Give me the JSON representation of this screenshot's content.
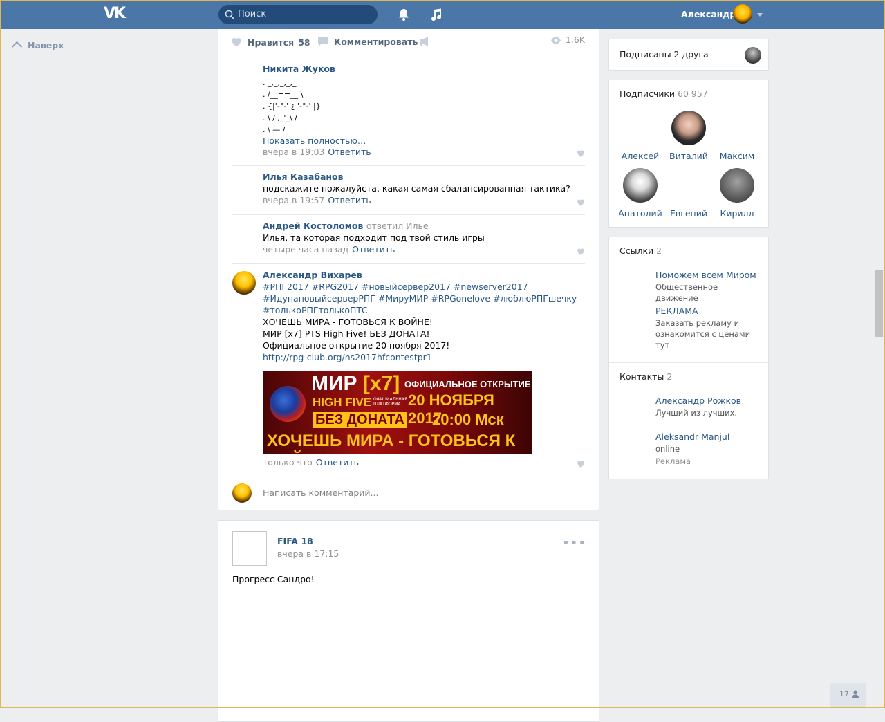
{
  "topbar": {
    "logo": "VK",
    "search_placeholder": "Поиск",
    "user_name": "Александр"
  },
  "left": {
    "up_label": "Наверх"
  },
  "post": {
    "like_label": "Нравится",
    "like_count": "58",
    "comment_label": "Комментировать",
    "views": "1.6K",
    "comments": [
      {
        "author": "Никита Жуков",
        "lines": [
          ". _,_,_,_,_",
          ". /__==__ \\",
          ". {|'-°-' ¿ '-°-' |}",
          ". \\ / ,_'_\\ /",
          ". \\ — /"
        ],
        "more": "Показать полностью…",
        "time": "вчера в 19:03",
        "reply": "Ответить"
      },
      {
        "author": "Илья Казабанов",
        "text": "подскажите пожалуйста, какая самая сбалансированная тактика?",
        "time": "вчера в 19:57",
        "reply": "Ответить"
      },
      {
        "author": "Андрей Костоломов",
        "reply_to": "ответил Илье",
        "text": "Илья, та которая подходит под твой стиль игры",
        "time": "четыре часа назад",
        "reply": "Ответить"
      },
      {
        "author": "Александр Вихарев",
        "tags1": "#РПГ2017 #RPG2017 #новыйсервер2017 #newserver2017",
        "tags2": "#ИдунановыйсерверРПГ #МируМИР #RPGonelove #люблюРПГшечку",
        "tags3": "#толькоРПГтолькоПТС",
        "line1": "ХОЧЕШЬ МИРА - ГОТОВЬСЯ К ВОЙНЕ!",
        "line2": "МИР [x7] PTS High Five! БЕЗ ДОНАТА!",
        "line3": "Официальное открытие 20 ноября 2017!",
        "link": "http://rpg-club.org/ns2017hfcontestpr1",
        "time": "только что",
        "reply": "Ответить",
        "banner": {
          "t1": "МИР ",
          "t1b": "[x7]",
          "t2": "HIGH FIVE",
          "t2s": "ОФИЦИАЛЬНАЯ ПЛАТФОРМА",
          "t3": "БЕЗ ДОНАТА",
          "t4": "ОФИЦИАЛЬНОЕ ОТКРЫТИЕ",
          "t5": "20 НОЯБРЯ 2017",
          "t6": "20:00 Мск",
          "t7": "ХОЧЕШЬ МИРА - ГОТОВЬСЯ К ВОЙНЕ"
        }
      }
    ],
    "write_placeholder": "Написать комментарий..."
  },
  "post2": {
    "author": "FIFA 18",
    "time": "вчера в 17:15",
    "text": "Прогресс Сандро!"
  },
  "sidebar": {
    "friends_label": "Подписаны 2 друга",
    "subs_title": "Подписчики",
    "subs_count": "60 957",
    "subs": [
      "Алексей",
      "Виталий",
      "Максим",
      "Анатолий",
      "Евгений",
      "Кирилл"
    ],
    "links_title": "Ссылки",
    "links_count": "2",
    "links": [
      {
        "title": "Поможем всем Миром",
        "desc": "Общественное движение"
      },
      {
        "title": "РЕКЛАМА",
        "desc": "Заказать рекламу и ознакомится с ценами тут"
      }
    ],
    "contacts_title": "Контакты",
    "contacts_count": "2",
    "contacts": [
      {
        "name": "Александр Рожков",
        "desc": "Лучший из лучших."
      },
      {
        "name": "Aleksandr Manjul",
        "status": "online",
        "desc": "Реклама"
      }
    ]
  },
  "online_count": "17",
  "colors": {
    "header": "#4a76a8",
    "link": "#2a5885",
    "bg": "#edeef0"
  }
}
